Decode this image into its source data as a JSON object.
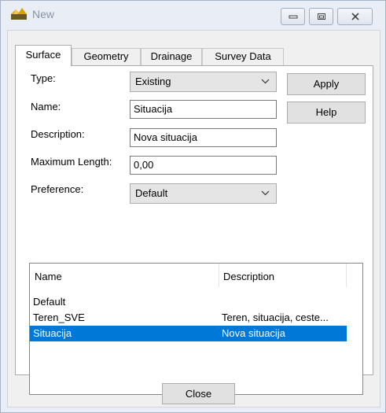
{
  "window": {
    "title": "New",
    "controls": {
      "minimize": "minimize",
      "maximize": "maximize",
      "close": "close"
    }
  },
  "tabs": [
    {
      "label": "Surface",
      "active": true
    },
    {
      "label": "Geometry",
      "active": false
    },
    {
      "label": "Drainage",
      "active": false
    },
    {
      "label": "Survey Data",
      "active": false
    }
  ],
  "form": {
    "type_label": "Type:",
    "type_value": "Existing",
    "name_label": "Name:",
    "name_value": "Situacija",
    "description_label": "Description:",
    "description_value": "Nova situacija",
    "max_length_label": "Maximum Length:",
    "max_length_value": "0,00",
    "preference_label": "Preference:",
    "preference_value": "Default"
  },
  "buttons": {
    "apply": "Apply",
    "help": "Help",
    "close": "Close"
  },
  "list": {
    "columns": [
      "Name",
      "Description"
    ],
    "rows": [
      {
        "name": "Default",
        "description": ""
      },
      {
        "name": "Teren_SVE",
        "description": "Teren, situacija, ceste..."
      },
      {
        "name": "Situacija",
        "description": "Nova situacija",
        "selected": true
      }
    ]
  },
  "colors": {
    "selection": "#0078d7",
    "panel": "#ffffff",
    "dialog": "#f0f0f0"
  }
}
